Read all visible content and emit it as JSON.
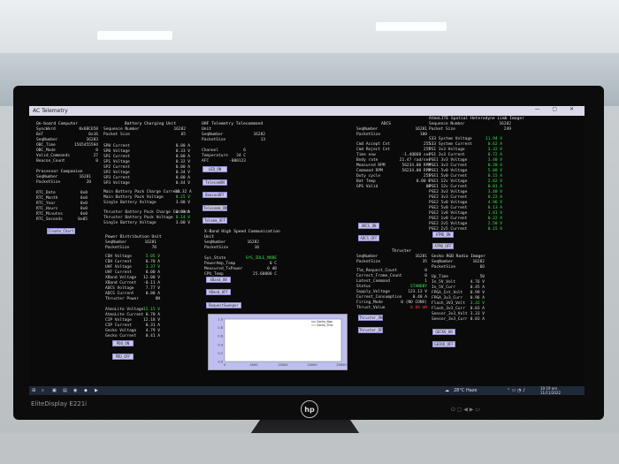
{
  "window": {
    "title": "AC Telemetry",
    "controls": "— ▢ ✕"
  },
  "onboard": {
    "title": "On-board Computer",
    "rows": [
      [
        "SyncWord",
        "0x6BC658"
      ],
      [
        "BoT",
        "0x16"
      ],
      [
        "SeqNumber",
        "16283"
      ],
      [
        "OBC_Time",
        "1565455594"
      ],
      [
        "OBC_Mode",
        "0"
      ],
      [
        "Valid_Commands",
        "27"
      ],
      [
        "Beacon_Count",
        "0"
      ]
    ],
    "proc_title": "Processor Companion",
    "proc_rows": [
      [
        "SeqNumber",
        "16281"
      ],
      [
        "PacketSize",
        "20"
      ]
    ],
    "rtc_rows": [
      [
        "RTC_Date",
        "0x0"
      ],
      [
        "RTC_Month",
        "0x0"
      ],
      [
        "RTC_Year",
        "0x0"
      ],
      [
        "RTC_Hours",
        "0x0"
      ],
      [
        "RTC_Minutes",
        "0x0"
      ],
      [
        "RTC_Seconds",
        "0x05"
      ]
    ],
    "button": "Create_Chart"
  },
  "battery": {
    "title": "Battery Charging Unit",
    "header": [
      [
        "Sequence Number",
        "16282"
      ],
      [
        "Packet Size",
        "65"
      ]
    ],
    "rows": [
      [
        "SP0 Current",
        "0.00 A"
      ],
      [
        "SP0 Voltage",
        "0.33 V"
      ],
      [
        "SP1 Current",
        "0.00 A"
      ],
      [
        "SP1 Voltage",
        "0.32 V"
      ],
      [
        "SP2 Current",
        "0.00 A"
      ],
      [
        "SP2 Voltage",
        "0.34 V"
      ],
      [
        "SP3 Current",
        "0.00 A"
      ],
      [
        "SP3 Voltage",
        "0.44 V"
      ]
    ],
    "main_rows": [
      [
        "Main Battery Pack Charge Current",
        "-16.32 A"
      ],
      [
        "Main Battery Pack Voltage",
        "8.25 V"
      ],
      [
        "Single Battery Voltage",
        "3.00 V"
      ]
    ],
    "thr_rows": [
      [
        "Thruster Battery Pack Charge Current",
        "0.03 A"
      ],
      [
        "Thruster Battery Pack Voltage",
        "8.14 V"
      ],
      [
        "Single Battery Voltage",
        "3.00 V"
      ]
    ]
  },
  "power": {
    "title": "Power Distribution Unit",
    "header": [
      [
        "SeqNumber",
        "16281"
      ],
      [
        "PacketSize",
        "70"
      ]
    ],
    "rows": [
      [
        "CDH Voltage",
        "5.05 V"
      ],
      [
        "CDH Current",
        "0.70 A"
      ],
      [
        "UHF Voltage",
        "3.37 V"
      ],
      [
        "UHF Current",
        "0.00 A"
      ],
      [
        "XBand Voltage",
        "12.00 V"
      ],
      [
        "XBand Current",
        "-0.11 A"
      ],
      [
        "ADCS Voltage",
        "7.77 V"
      ],
      [
        "ADCS Current",
        "0.00 A"
      ],
      [
        "Thruster Power",
        "ON"
      ]
    ],
    "rows2": [
      [
        "AtmoLite Voltage",
        "12.15 V"
      ],
      [
        "AtmoLite Current",
        "0.70 A"
      ],
      [
        "CIP Voltage",
        "12.18 V"
      ],
      [
        "CIP Current",
        "0.31 A"
      ],
      [
        "Gecko Voltage",
        "4.79 V"
      ],
      [
        "Gecko Current",
        "0.41 A"
      ]
    ],
    "buttons": [
      "PDU_ON",
      "PDU_OFF"
    ]
  },
  "uhf": {
    "title": "UHF Telemetry Telecommand Unit",
    "header": [
      [
        "SeqNumber",
        "16282"
      ],
      [
        "PacketSize",
        "13"
      ]
    ],
    "rows": [
      [
        "Channel",
        "6"
      ],
      [
        "Temperature",
        "34 C"
      ],
      [
        "AFC",
        "-000123"
      ]
    ],
    "buttons": [
      "LED_ON",
      "TelecomON",
      "BeaconOFF",
      "Telecomm_ON",
      "Telemm_OFF"
    ]
  },
  "xband": {
    "title": "X-Band High Speed Communication Unit",
    "header": [
      [
        "SeqNumber",
        "16282"
      ],
      [
        "PacketSize",
        "10"
      ]
    ],
    "rows": [
      [
        "Sys_State",
        "SYS_IDLE_MODE"
      ],
      [
        "PowerAmp_Temp",
        "0 C"
      ],
      [
        "Measured_TxPower",
        "0 dB"
      ],
      [
        "CPU_Temp",
        "25.60000 C"
      ]
    ],
    "buttons": [
      "XBand_ON",
      "XBand_OFF",
      "RequestSweeper"
    ]
  },
  "chart_data": {
    "type": "line",
    "series": [
      {
        "name": "Gecko_Ngo",
        "values": []
      },
      {
        "name": "Gecko_Tmp",
        "values": []
      }
    ],
    "x_ticks": [
      "0",
      "5000",
      "10000",
      "15000",
      "20000"
    ],
    "y_ticks": [
      "0.0",
      "0.2",
      "0.4",
      "0.6",
      "0.8",
      "1.0"
    ],
    "xlim": [
      0,
      20000
    ],
    "ylim": [
      0,
      1
    ]
  },
  "adcs": {
    "title": "ADCS",
    "header": [
      [
        "SeqNumber",
        "16281"
      ],
      [
        "PacketSize",
        "100"
      ]
    ],
    "rows": [
      [
        "Cmd Accept Cnt",
        "255"
      ],
      [
        "Cmd Reject Cnt",
        "255"
      ],
      [
        "Time now",
        "-1.4Q860 sec"
      ],
      [
        "Body rate",
        "21.47 rad/sec"
      ],
      [
        "Measured RPM",
        "56234.00 RPM"
      ],
      [
        "Command RPM",
        "56234.00 RPM"
      ],
      [
        "Duty cycle",
        "255"
      ],
      [
        "Bat Temp",
        "0.00 C"
      ],
      [
        "GPS Valid",
        "00"
      ]
    ],
    "buttons": [
      "ADCS_ON",
      "ADCS_OFF"
    ]
  },
  "thruster": {
    "title": "Thruster",
    "header": [
      [
        "SeqNumber",
        "16281"
      ],
      [
        "PacketSize",
        "35"
      ]
    ],
    "rows": [
      [
        "Tlm_Request_Count",
        "0"
      ],
      [
        "Correct_Frame_Count",
        "0"
      ],
      [
        "Latest_Command",
        "1"
      ],
      [
        "Status",
        "STANDBY"
      ],
      [
        "Supply_Voltage",
        "123.13 V"
      ],
      [
        "Current_Consumption",
        "0.40 A"
      ],
      [
        "Firing_Mode",
        "0 (NO CONV)"
      ],
      [
        "Thrust_Value",
        "0.00 mN"
      ]
    ],
    "buttons": [
      "Thruster_ON",
      "Thruster_OFF"
    ]
  },
  "atmolite": {
    "title": "AtmoLITE Spatial Heterodyne Limb Imager",
    "header": [
      [
        "Sequence Number",
        "16282"
      ],
      [
        "Packet Size",
        "249"
      ]
    ],
    "rows": [
      [
        "S33 System Voltage",
        "11.94 V"
      ],
      [
        "S33 System Current",
        "0.62 A"
      ],
      [
        "PS1 3v3 Voltage",
        "3.32 V"
      ],
      [
        "PS1 3v3 Current",
        "0.72 A"
      ],
      [
        "PSE1 3v3 Voltage",
        "3.40 V"
      ],
      [
        "PSE1 3v3 Current",
        "0.20 A"
      ],
      [
        "PSE1 5v0 Voltage",
        "5.00 V"
      ],
      [
        "PSE1 5v0 Current",
        "0.15 A"
      ],
      [
        "PSE1 12v Voltage",
        "2.82 V"
      ],
      [
        "PSE1 12v Current",
        "0.01 A"
      ],
      [
        "PSE2 3v3 Voltage",
        "3.40 V"
      ],
      [
        "PSE2 3v3 Current",
        "0.22 A"
      ],
      [
        "PSE2 5v0 Voltage",
        "4.96 V"
      ],
      [
        "PSE2 5v0 Current",
        "0.13 A"
      ],
      [
        "PSE2 1v8 Voltage",
        "1.81 V"
      ],
      [
        "PSE2 1v8 Current",
        "0.22 A"
      ],
      [
        "PSE2 2v5 Voltage",
        "2.50 V"
      ],
      [
        "PSE2 2v5 Current",
        "0.15 A"
      ]
    ],
    "buttons": [
      "ATMO_ON",
      "ATMO_OFF"
    ]
  },
  "gecko": {
    "title": "Gecko RGB Radio Imager",
    "header": [
      [
        "SeqNumber",
        "16282"
      ],
      [
        "PacketSize",
        "66"
      ]
    ],
    "rows": [
      [
        "Up_Time",
        "50"
      ],
      [
        "In_5V_Volt",
        "4.76 V"
      ],
      [
        "In_5V_Curr",
        "0.45 A"
      ],
      [
        "FPGA_Int_Volt",
        "0.99 V"
      ],
      [
        "FPGA_3v3_Curr",
        "0.96 A"
      ],
      [
        "Flash_3V3_Volt",
        "3.32 V"
      ],
      [
        "Flash_3v3_Curr",
        "0.03 A"
      ],
      [
        "Sensor_3v3_Volt",
        "3.33 V"
      ],
      [
        "Sensor_3v3_Curr",
        "0.03 A"
      ]
    ],
    "buttons": [
      "GECKO_ON",
      "GECKO_OFF"
    ]
  },
  "taskbar": {
    "weather": "28°C Haze",
    "time": "10:19 am",
    "date": "11/11/2022"
  },
  "monitor": {
    "brand": "EliteDisplay E221i",
    "logo": "hp"
  }
}
